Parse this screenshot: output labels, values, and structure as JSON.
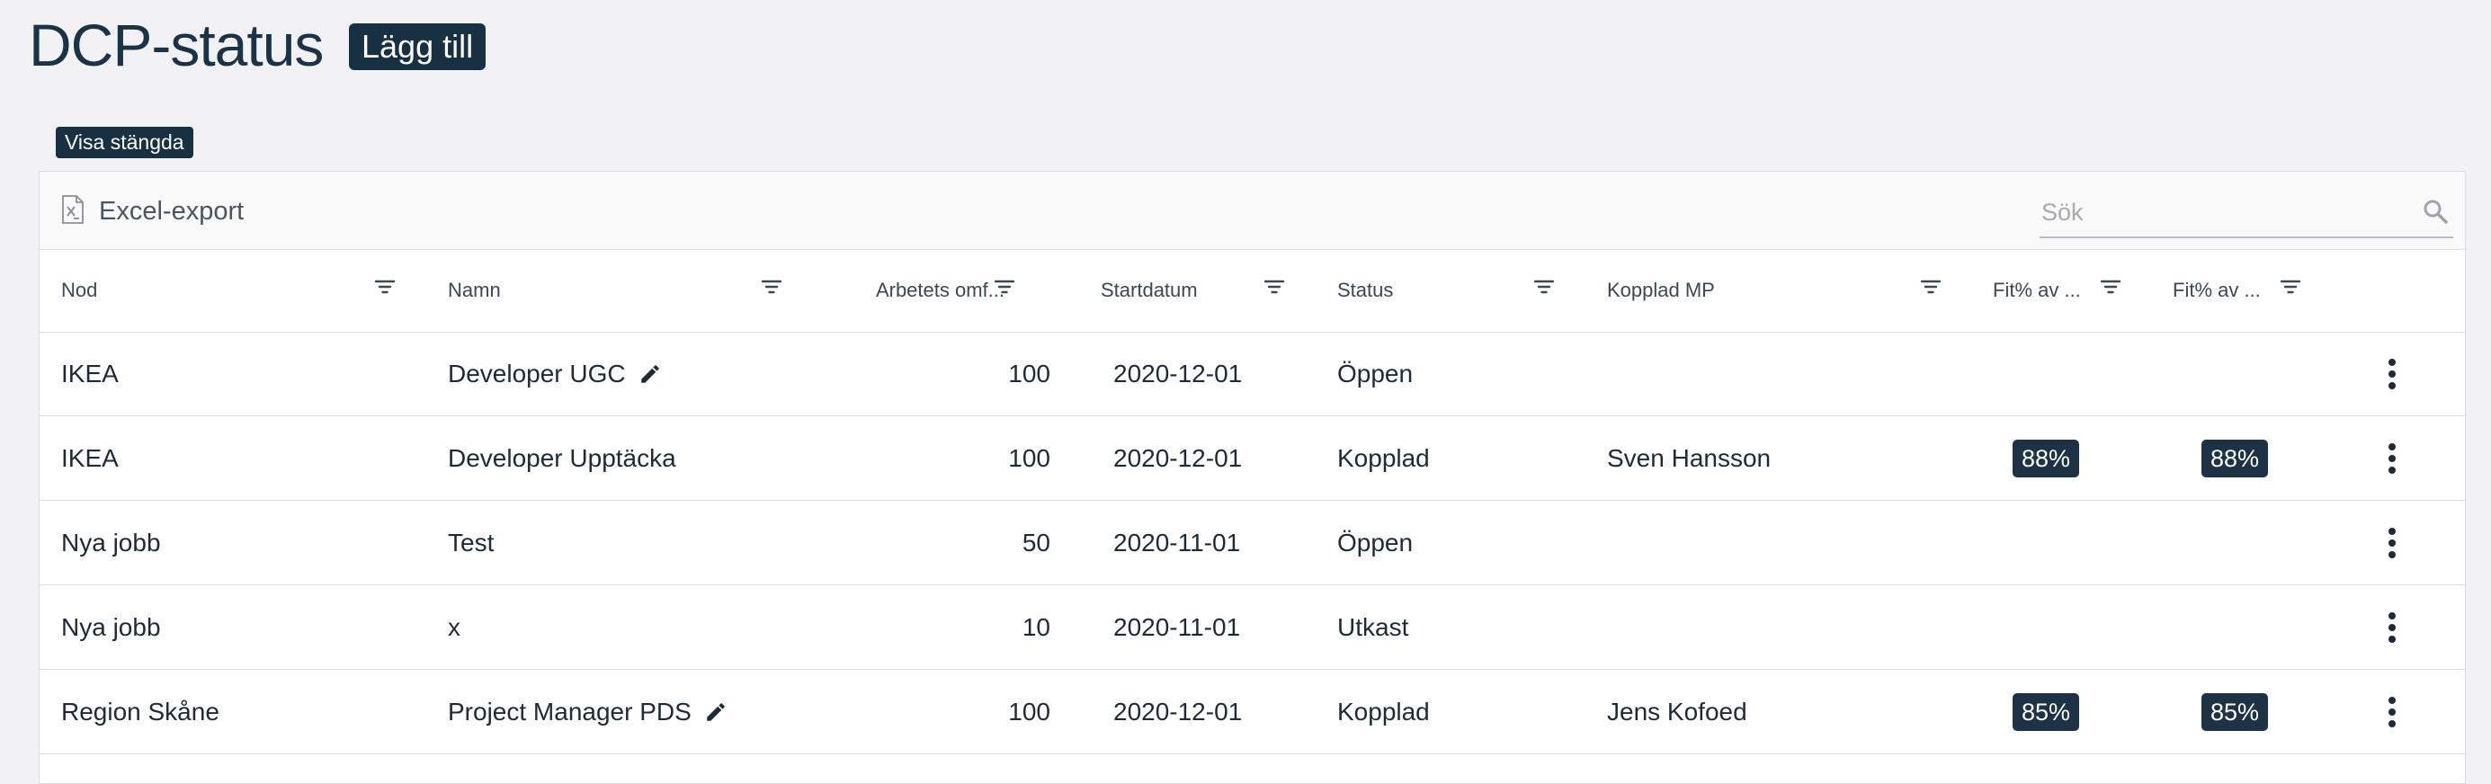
{
  "page": {
    "title": "DCP-status",
    "add_label": "Lägg till",
    "show_closed_label": "Visa stängda"
  },
  "toolbar": {
    "export_label": "Excel-export",
    "search_placeholder": "Sök"
  },
  "columns": [
    "Nod",
    "Namn",
    "Arbetets omf...",
    "Startdatum",
    "Status",
    "Kopplad MP",
    "Fit% av ...",
    "Fit% av ..."
  ],
  "rows": [
    {
      "nod": "IKEA",
      "namn": "Developer UGC",
      "editable": true,
      "omf": "100",
      "start": "2020-12-01",
      "status": "Öppen",
      "mp": "",
      "fit1": "",
      "fit2": ""
    },
    {
      "nod": "IKEA",
      "namn": "Developer Upptäcka",
      "editable": false,
      "omf": "100",
      "start": "2020-12-01",
      "status": "Kopplad",
      "mp": "Sven Hansson",
      "fit1": "88%",
      "fit2": "88%"
    },
    {
      "nod": "Nya jobb",
      "namn": "Test",
      "editable": false,
      "omf": "50",
      "start": "2020-11-01",
      "status": "Öppen",
      "mp": "",
      "fit1": "",
      "fit2": ""
    },
    {
      "nod": "Nya jobb",
      "namn": "x",
      "editable": false,
      "omf": "10",
      "start": "2020-11-01",
      "status": "Utkast",
      "mp": "",
      "fit1": "",
      "fit2": ""
    },
    {
      "nod": "Region Skåne",
      "namn": "Project Manager PDS",
      "editable": true,
      "omf": "100",
      "start": "2020-12-01",
      "status": "Kopplad",
      "mp": "Jens Kofoed",
      "fit1": "85%",
      "fit2": "85%"
    }
  ],
  "icons": {
    "export": "excel-file-icon",
    "search": "search-icon",
    "filter": "filter-icon",
    "edit": "pencil-icon",
    "more": "more-vert-icon"
  },
  "colors": {
    "primary": "#173042",
    "background": "#f2f2f4"
  }
}
